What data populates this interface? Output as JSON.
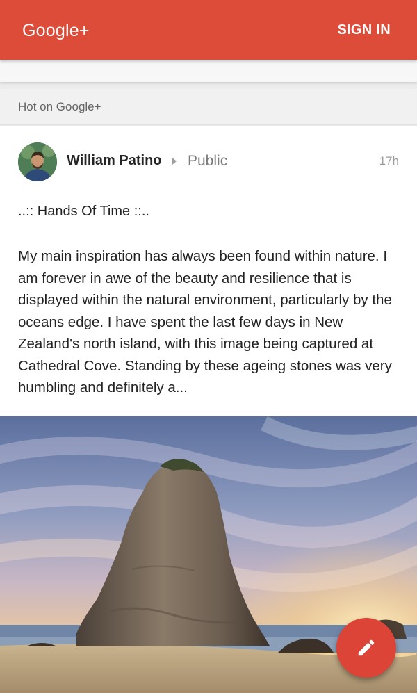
{
  "appbar": {
    "brand": "Google+",
    "sign_in_label": "SIGN IN",
    "color": "#dd4b39"
  },
  "section": {
    "header": "Hot on Google+"
  },
  "post": {
    "author": "William Patino",
    "visibility": "Public",
    "time": "17h",
    "title": "..:: Hands Of Time ::..",
    "body": "My main inspiration has always been found within nature. I am forever in awe of the beauty and resilience that is displayed within the natural environment, particularly by the oceans edge. I have spent the last few days in New Zealand's north island, with this image being captured at Cathedral Cove. Standing by these ageing stones was very humbling and definitely a..."
  },
  "fab": {
    "icon": "pencil-icon",
    "color": "#db4437"
  }
}
